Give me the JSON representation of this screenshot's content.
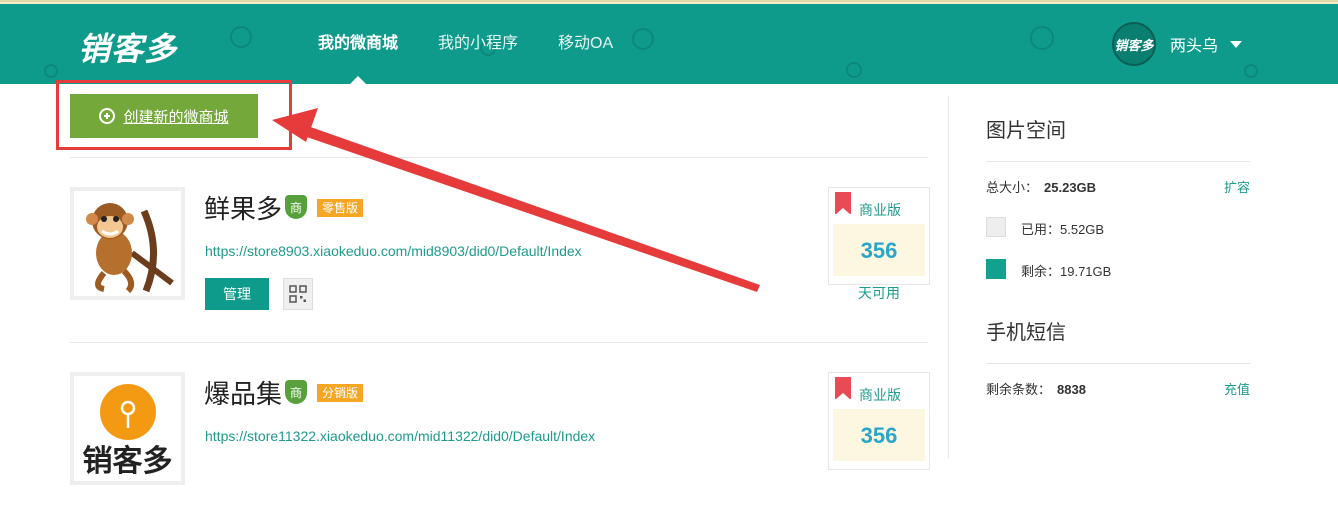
{
  "header": {
    "logo_text": "销客多",
    "nav": [
      {
        "label": "我的微商城",
        "active": true
      },
      {
        "label": "我的小程序",
        "active": false
      },
      {
        "label": "移动OA",
        "active": false
      }
    ],
    "avatar_text": "销客多",
    "username": "两头乌"
  },
  "main": {
    "create_button_label": "创建新的微商城",
    "stores": [
      {
        "name": "鲜果多",
        "badge": "商",
        "edition": "零售版",
        "url": "https://store8903.xiaokeduo.com/mid8903/did0/Default/Index",
        "manage_label": "管理",
        "plan_name": "商业版",
        "days": "356",
        "days_suffix": "天可用"
      },
      {
        "name": "爆品集",
        "badge": "商",
        "edition": "分销版",
        "url": "https://store11322.xiaokeduo.com/mid11322/did0/Default/Index",
        "plan_name": "商业版",
        "days": "356",
        "thumb_text": "销客多"
      }
    ]
  },
  "sidebar": {
    "image_space": {
      "title": "图片空间",
      "total_label": "总大小：",
      "total_value": "25.23GB",
      "expand_label": "扩容",
      "used_label": "已用：5.52GB",
      "remaining_label": "剩余：19.71GB"
    },
    "sms": {
      "title": "手机短信",
      "remaining_label": "剩余条数：",
      "remaining_value": "8838",
      "recharge_label": "充值"
    }
  },
  "colors": {
    "brand": "#0e9b8b",
    "create_button": "#75a83a",
    "annotation_red": "#e53b3b",
    "edition_badge": "#f5a623"
  }
}
